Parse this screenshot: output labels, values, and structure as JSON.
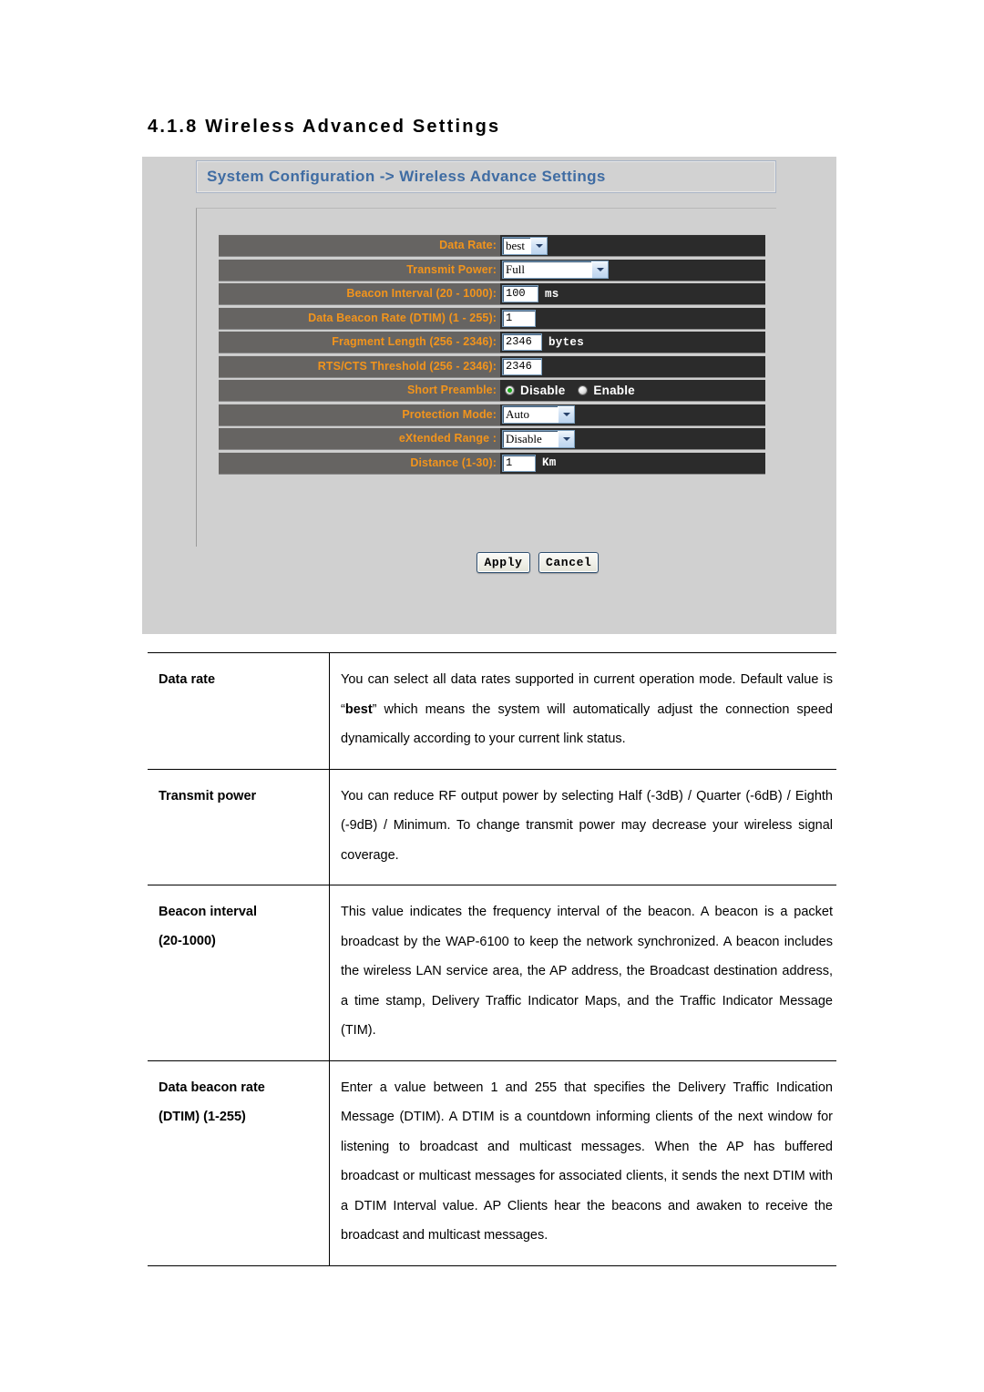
{
  "section": {
    "heading": "4.1.8 Wireless Advanced Settings"
  },
  "screenshot": {
    "page_header": "System Configuration -> Wireless Advance Settings",
    "fields": [
      {
        "label": "Data Rate:",
        "control": "select",
        "value": "best"
      },
      {
        "label": "Transmit Power:",
        "control": "select",
        "value": "Full"
      },
      {
        "label": "Beacon Interval (20 - 1000):",
        "control": "input",
        "value": "100",
        "unit": "ms"
      },
      {
        "label": "Data Beacon Rate (DTIM) (1 - 255):",
        "control": "input",
        "value": "1",
        "unit": ""
      },
      {
        "label": "Fragment Length (256 - 2346):",
        "control": "input",
        "value": "2346",
        "unit": "bytes"
      },
      {
        "label": "RTS/CTS Threshold (256 - 2346):",
        "control": "input",
        "value": "2346",
        "unit": ""
      },
      {
        "label": "Short Preamble:",
        "control": "radio",
        "options": [
          "Disable",
          "Enable"
        ],
        "selected": "Disable"
      },
      {
        "label": "Protection Mode:",
        "control": "select",
        "value": "Auto"
      },
      {
        "label": "eXtended Range :",
        "control": "select",
        "value": "Disable"
      },
      {
        "label": "Distance (1-30):",
        "control": "input",
        "value": "1",
        "unit": "Km"
      }
    ],
    "buttons": {
      "apply": "Apply",
      "cancel": "Cancel"
    },
    "colors": {
      "panel_bg": "#d0d0d0",
      "row_label_bg": "#666462",
      "row_field_bg": "#2b2b2b",
      "label_text": "#f2941c",
      "header_text": "#3f6ca3",
      "radio_selected": "#1aa81a"
    }
  },
  "description_table": {
    "rows": [
      {
        "term": "Data rate",
        "term_sub": "",
        "desc_pre": "You can select all data rates supported in current operation mode. Default value is “",
        "desc_bold": "best",
        "desc_post": "” which means the system will automatically adjust the connection speed dynamically according to your current link status."
      },
      {
        "term": "Transmit power",
        "term_sub": "",
        "desc_pre": "You can reduce RF output power by selecting Half (-3dB) / Quarter (-6dB) / Eighth (-9dB) / Minimum. To change transmit power may decrease your wireless signal coverage.",
        "desc_bold": "",
        "desc_post": ""
      },
      {
        "term": "Beacon interval",
        "term_sub": "(20-1000)",
        "desc_pre": "This value indicates the frequency interval of the beacon. A beacon is a packet broadcast by the WAP-6100 to keep the network synchronized. A beacon includes the wireless LAN service area, the AP address, the Broadcast destination address, a time stamp, Delivery Traffic Indicator Maps, and the Traffic Indicator Message (TIM).",
        "desc_bold": "",
        "desc_post": ""
      },
      {
        "term": "Data beacon rate",
        "term_sub": "(DTIM) (1-255)",
        "desc_pre": "Enter a value between 1 and 255 that specifies the Delivery Traffic Indication Message (DTIM). A DTIM is a countdown informing clients of the next window for listening to broadcast and multicast messages. When the AP has buffered broadcast or multicast messages for associated clients, it sends the next DTIM with a DTIM Interval value. AP Clients hear the beacons and awaken to receive the broadcast and multicast messages.",
        "desc_bold": "",
        "desc_post": ""
      }
    ]
  }
}
